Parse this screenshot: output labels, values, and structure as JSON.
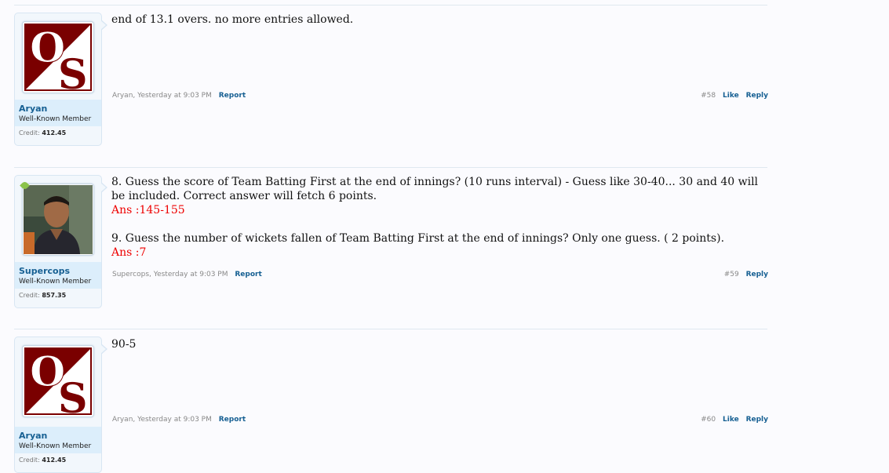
{
  "posts": [
    {
      "user": {
        "name": "Aryan",
        "title": "Well-Known Member",
        "credit_label": "Credit",
        "credit_value": "412.45",
        "avatar": "os-logo"
      },
      "lines": [
        "end of 13.1 overs. no more entries allowed."
      ],
      "meta": {
        "author": "Aryan",
        "time": "Yesterday at 9:03 PM",
        "report": "Report",
        "number": "#58",
        "like": "Like",
        "reply": "Reply"
      }
    },
    {
      "user": {
        "name": "Supercops",
        "title": "Well-Known Member",
        "credit_label": "Credit",
        "credit_value": "857.35",
        "avatar": "user-photo"
      },
      "lines": [
        "8. Guess the score of Team Batting First at the end of innings? (10 runs interval) - Guess like 30-40... 30 and 40 will be included. Correct answer will fetch 6 points.",
        "Ans :145-155",
        "9. Guess the number of wickets fallen of Team Batting First at the end of innings? Only one guess. ( 2 points).",
        "Ans :7"
      ],
      "meta": {
        "author": "Supercops",
        "time": "Yesterday at 9:03 PM",
        "report": "Report",
        "number": "#59",
        "reply": "Reply"
      }
    },
    {
      "user": {
        "name": "Aryan",
        "title": "Well-Known Member",
        "credit_label": "Credit",
        "credit_value": "412.45",
        "avatar": "os-logo"
      },
      "lines": [
        "90-5"
      ],
      "meta": {
        "author": "Aryan",
        "time": "Yesterday at 9:03 PM",
        "report": "Report",
        "number": "#60",
        "like": "Like",
        "reply": "Reply"
      }
    }
  ],
  "colors": {
    "link": "#176093",
    "answer": "#ee0000",
    "logo": "#7a0000"
  }
}
